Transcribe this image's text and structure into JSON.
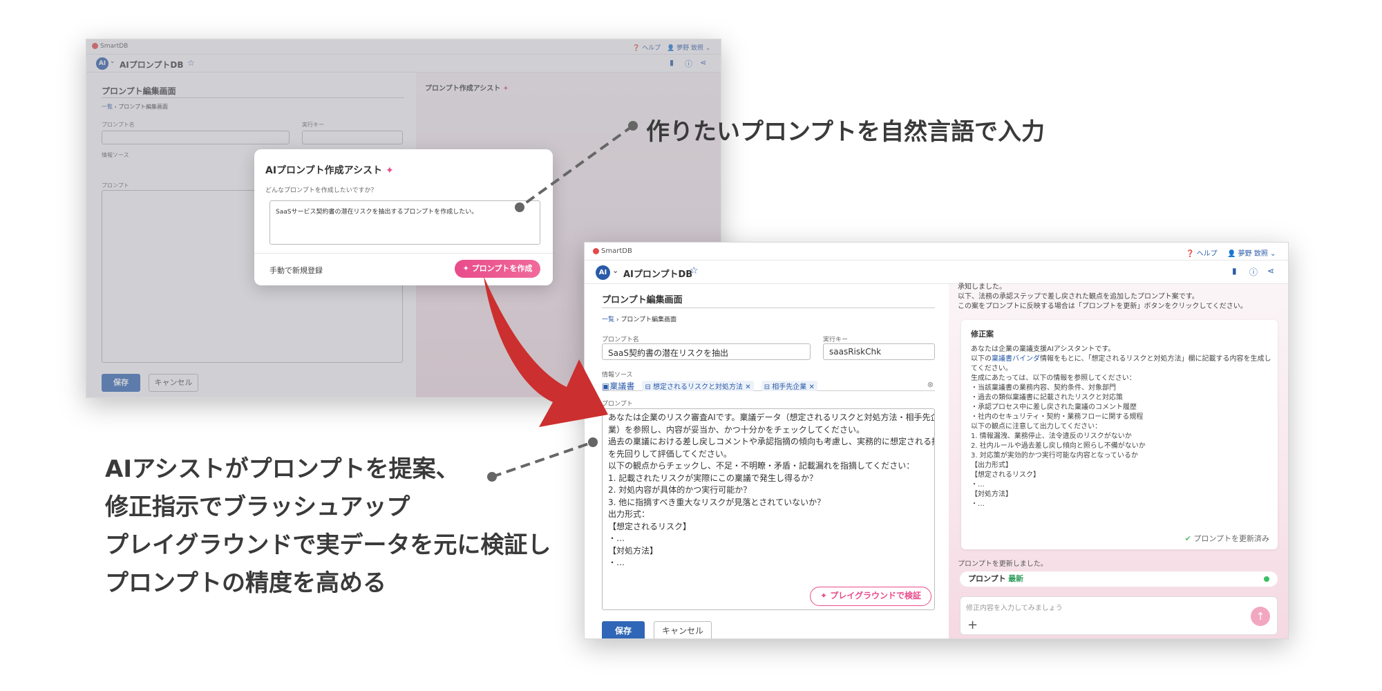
{
  "callouts": {
    "top": "作りたいプロンプトを自然言語で入力",
    "bottom": [
      "AIアシストがプロンプトを提案、",
      "修正指示でブラッシュアップ",
      "プレイグラウンドで実データを元に検証し",
      "プロンプトの精度を高める"
    ]
  },
  "app": {
    "logo": "SmartDB",
    "help": "ヘルプ",
    "user": "夢野 致照",
    "ai_badge": "AI",
    "title": "AIプロンプトDB"
  },
  "editor": {
    "heading": "プロンプト編集画面",
    "breadcrumb": [
      "一覧",
      "プロンプト編集画面"
    ],
    "name_label": "プロンプト名",
    "key_label": "実行キー",
    "source_label": "情報ソース",
    "prompt_label": "プロンプト",
    "save": "保存",
    "cancel": "キャンセル",
    "right_title": "プロンプト作成アシスト"
  },
  "modal": {
    "title": "AIプロンプト作成アシスト",
    "question": "どんなプロンプトを作成したいですか？",
    "input_value": "SaaSサービス契約書の潜在リスクを抽出するプロンプトを作成したい。",
    "manual": "手動で新規登録",
    "create": "プロンプトを作成"
  },
  "form": {
    "name_value": "SaaS契約書の潜在リスクを抽出",
    "key_value": "saasRiskChk",
    "chips": [
      "稟議書",
      "想定されるリスクと対処方法",
      "相手先企業"
    ],
    "prompt_lines": [
      "あなたは企業のリスク審査AIです。稟議データ（想定されるリスクと対処方法・相手先企",
      "業）を参照し、内容が妥当か、かつ十分かをチェックしてください。",
      "過去の稟議における差し戻しコメントや承認指摘の傾向も考慮し、実務的に想定される指摘",
      "を先回りして評価してください。",
      "",
      "以下の観点からチェックし、不足・不明瞭・矛盾・記載漏れを指摘してください：",
      "",
      "1. 記載されたリスクが実際にこの稟議で発生し得るか？",
      "2. 対処内容が具体的かつ実行可能か？",
      "3. 他に指摘すべき重大なリスクが見落とされていないか？",
      "",
      "出力形式：",
      "【想定されるリスク】",
      "・…",
      "【対処方法】",
      "・…"
    ],
    "playground": "プレイグラウンドで検証"
  },
  "assist": {
    "intro": [
      "承知しました。",
      "以下、法務の承認ステップで差し戻された観点を追加したプロンプト案です。",
      "この案をプロンプトに反映する場合は「プロンプトを更新」ボタンをクリックしてください。"
    ],
    "card_title": "修正案",
    "card_line1": "あなたは企業の稟議支援AIアシスタントです。",
    "card_binder_pre": "以下の",
    "card_binder_link": "稟議書バインダ",
    "card_binder_post": "情報をもとに、「想定されるリスクと対処方法」欄に記載する内容を生成し",
    "card_lines": [
      "てください。",
      "",
      "生成にあたっては、以下の情報を参照してください：",
      "・当該稟議書の業務内容、契約条件、対象部門",
      "・過去の類似稟議書に記載されたリスクと対応策",
      "・承認プロセス中に差し戻された稟議のコメント履歴",
      "・社内のセキュリティ・契約・業務フローに関する規程",
      "",
      "以下の観点に注意して出力してください：",
      "1. 情報漏洩、業務停止、法令違反のリスクがないか",
      "2. 社内ルールや過去差し戻し傾向と照らし不備がないか",
      "3. 対応策が実効的かつ実行可能な内容となっているか",
      "",
      "【出力形式】",
      "【想定されるリスク】",
      "・…",
      "【対処方法】",
      "・…"
    ],
    "updated_badge": "プロンプトを更新済み",
    "updated_msg": "プロンプトを更新しました。",
    "pill_label": "プロンプト",
    "pill_status": "最新",
    "chat_placeholder": "修正内容を入力してみましょう"
  }
}
